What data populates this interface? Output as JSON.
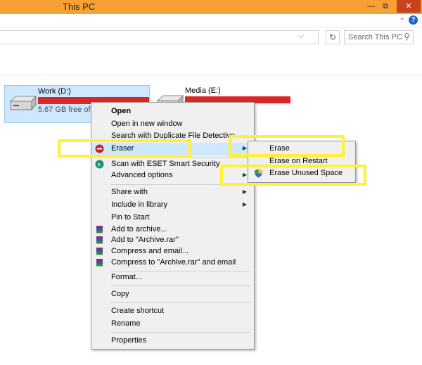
{
  "window": {
    "title": "This PC"
  },
  "titlebar": {
    "minimize_icon": "minimize-icon",
    "restore_icon": "restore-icon",
    "close_icon": "close-icon"
  },
  "ribbon": {
    "help_icon": "?"
  },
  "search": {
    "placeholder": "Search This PC"
  },
  "drives": [
    {
      "name": "Work (D:)",
      "free": "5.67 GB free of 16"
    },
    {
      "name": "Media (E:)"
    }
  ],
  "context_menu": {
    "items": [
      {
        "label": "Open"
      },
      {
        "label": "Open in new window"
      },
      {
        "label": "Search with Duplicate File Detective"
      },
      {
        "label": "Eraser"
      },
      {
        "label": "Scan with ESET Smart Security"
      },
      {
        "label": "Advanced options"
      },
      {
        "label": "Share with"
      },
      {
        "label": "Include in library"
      },
      {
        "label": "Pin to Start"
      },
      {
        "label": "Add to archive..."
      },
      {
        "label": "Add to \"Archive.rar\""
      },
      {
        "label": "Compress and email..."
      },
      {
        "label": "Compress to \"Archive.rar\" and email"
      },
      {
        "label": "Format..."
      },
      {
        "label": "Copy"
      },
      {
        "label": "Create shortcut"
      },
      {
        "label": "Rename"
      },
      {
        "label": "Properties"
      }
    ]
  },
  "eraser_submenu": {
    "items": [
      {
        "label": "Erase"
      },
      {
        "label": "Erase on Restart"
      },
      {
        "label": "Erase Unused Space"
      }
    ]
  },
  "colors": {
    "titlebar": "#f7a135",
    "highlight_box": "#fff03a",
    "drive_bar": "#da2626",
    "selection": "#cde8ff"
  }
}
